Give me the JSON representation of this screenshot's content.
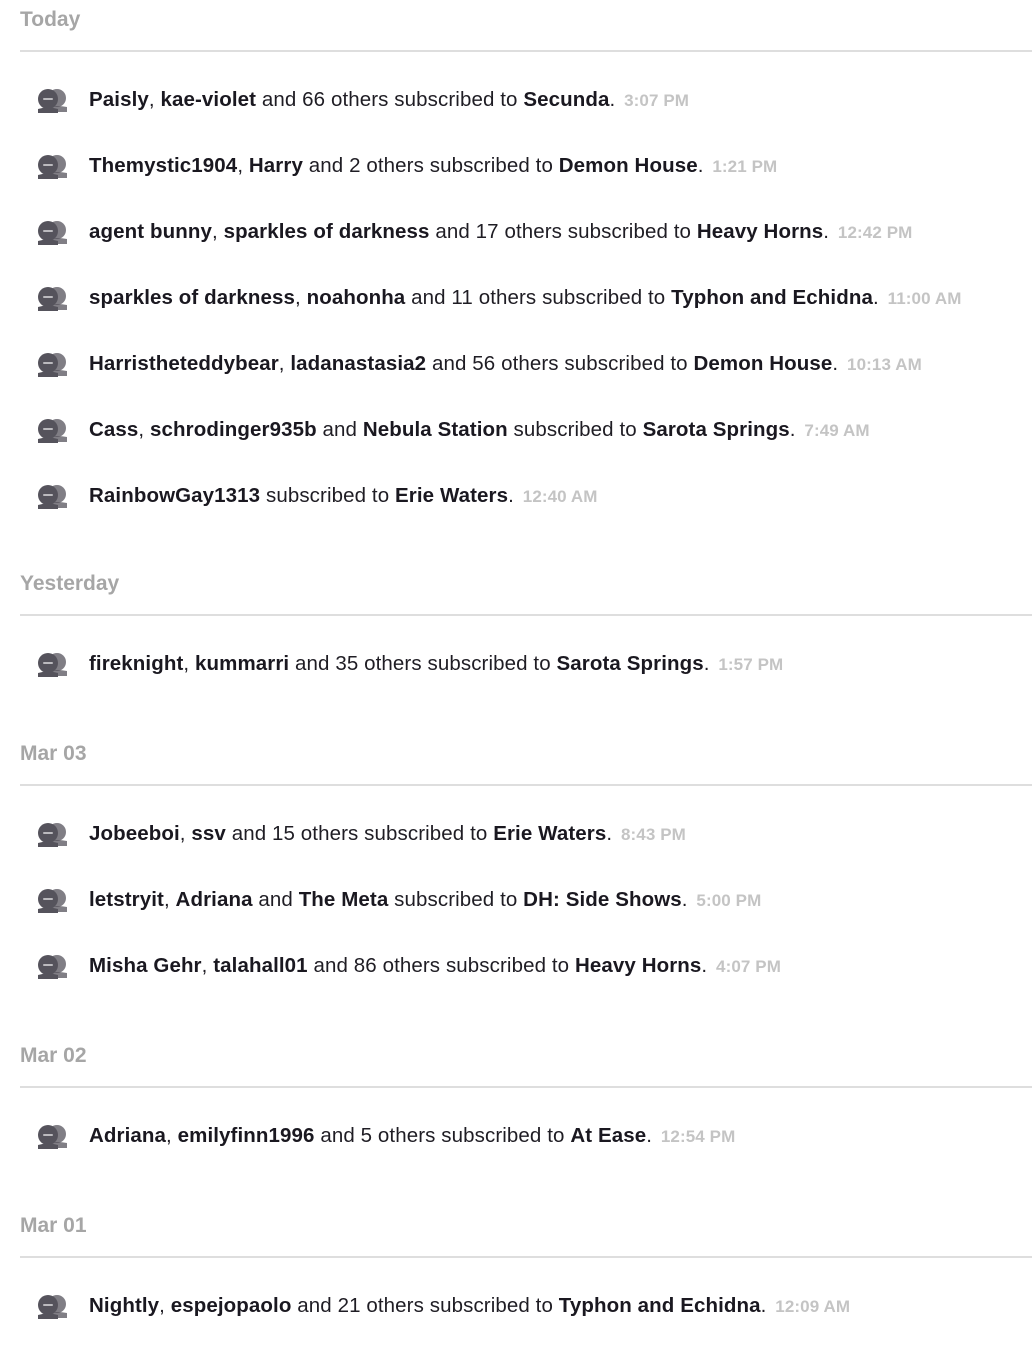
{
  "groups": [
    {
      "label": "Today",
      "entries": [
        {
          "users": [
            "Paisly",
            "kae-violet"
          ],
          "others": "66",
          "channel": "Secunda",
          "time": "3:07 PM"
        },
        {
          "users": [
            "Themystic1904",
            "Harry"
          ],
          "others": "2",
          "channel": "Demon House",
          "time": "1:21 PM"
        },
        {
          "users": [
            "agent bunny",
            "sparkles of darkness"
          ],
          "others": "17",
          "channel": "Heavy Horns",
          "time": "12:42 PM"
        },
        {
          "users": [
            "sparkles of darkness",
            "noahonha"
          ],
          "others": "11",
          "channel": "Typhon and Echidna",
          "time": "11:00 AM"
        },
        {
          "users": [
            "Harristheteddybear",
            "ladanastasia2"
          ],
          "others": "56",
          "channel": "Demon House",
          "time": "10:13 AM"
        },
        {
          "users": [
            "Cass",
            "schrodinger935b",
            "Nebula Station"
          ],
          "others": null,
          "channel": "Sarota Springs",
          "time": "7:49 AM"
        },
        {
          "users": [
            "RainbowGay1313"
          ],
          "others": null,
          "channel": "Erie Waters",
          "time": "12:40 AM"
        }
      ]
    },
    {
      "label": "Yesterday",
      "entries": [
        {
          "users": [
            "fireknight",
            "kummarri"
          ],
          "others": "35",
          "channel": "Sarota Springs",
          "time": "1:57 PM"
        }
      ]
    },
    {
      "label": "Mar 03",
      "entries": [
        {
          "users": [
            "Jobeeboi",
            "ssv"
          ],
          "others": "15",
          "channel": "Erie Waters",
          "time": "8:43 PM"
        },
        {
          "users": [
            "letstryit",
            "Adriana",
            "The Meta"
          ],
          "others": null,
          "channel": "DH: Side Shows",
          "time": "5:00 PM"
        },
        {
          "users": [
            "Misha Gehr",
            "talahall01"
          ],
          "others": "86",
          "channel": "Heavy Horns",
          "time": "4:07 PM"
        }
      ]
    },
    {
      "label": "Mar 02",
      "entries": [
        {
          "users": [
            "Adriana",
            "emilyfinn1996"
          ],
          "others": "5",
          "channel": "At Ease",
          "time": "12:54 PM"
        }
      ]
    },
    {
      "label": "Mar 01",
      "entries": [
        {
          "users": [
            "Nightly",
            "espejopaolo"
          ],
          "others": "21",
          "channel": "Typhon and Echidna",
          "time": "12:09 AM"
        }
      ]
    }
  ],
  "phrases": {
    "and": "and",
    "others_suffix": "others",
    "subscribed_to": "subscribed to",
    "period": "."
  },
  "icon": "users-chat-icon",
  "colors": {
    "header_text": "#a6a6a6",
    "divider": "#dedede",
    "body_text": "#1f1d24",
    "timestamp": "#c4c4c4",
    "icon": "#55535c"
  }
}
